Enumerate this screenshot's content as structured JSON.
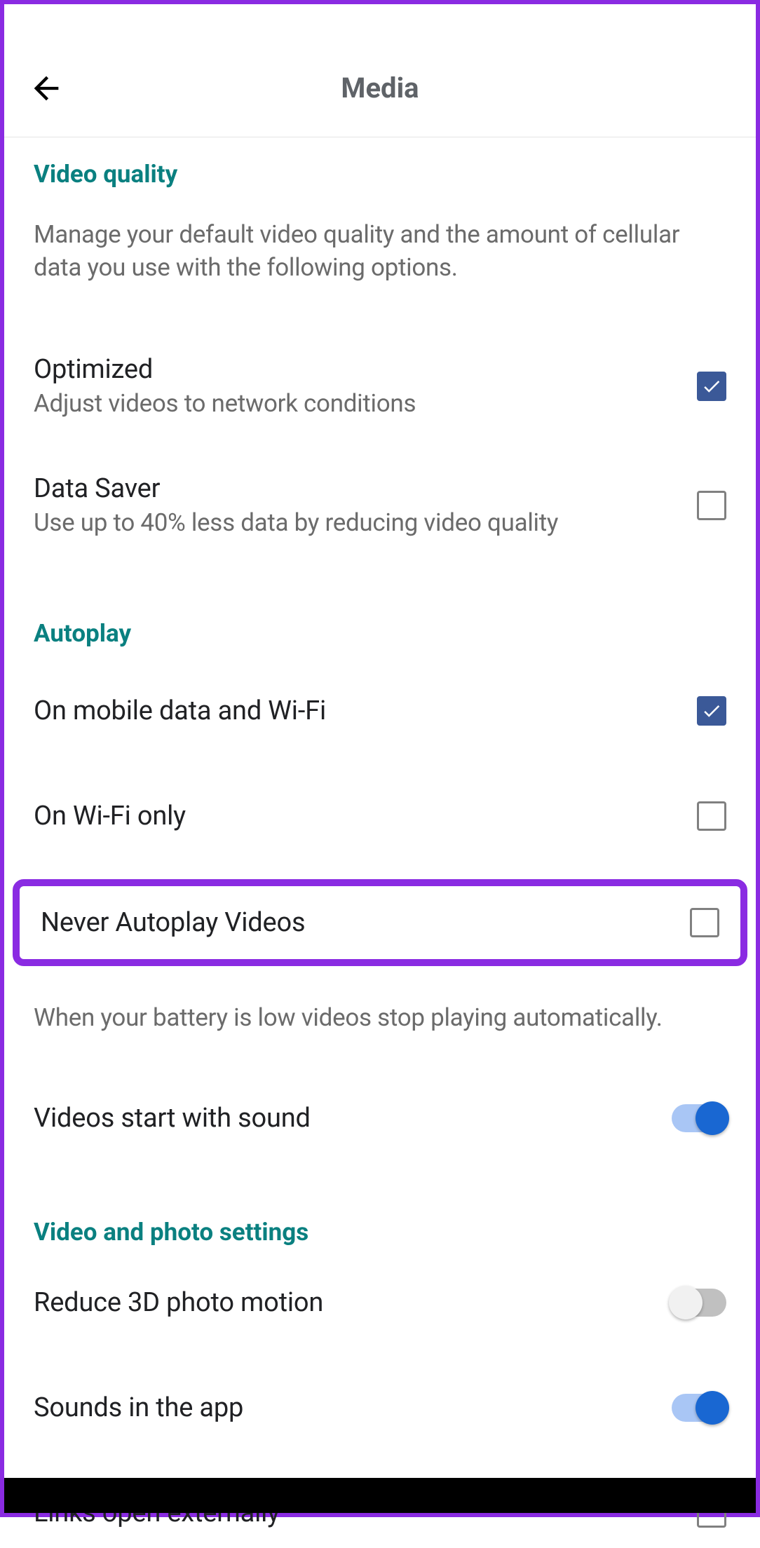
{
  "header": {
    "title": "Media"
  },
  "sections": {
    "video_quality": {
      "title": "Video quality",
      "desc": "Manage your default video quality and the amount of cellular data you use with the following options.",
      "optimized": {
        "label": "Optimized",
        "sub": "Adjust videos to network conditions"
      },
      "data_saver": {
        "label": "Data Saver",
        "sub": "Use up to 40% less data by reducing video quality"
      }
    },
    "autoplay": {
      "title": "Autoplay",
      "mobile_wifi": "On mobile data and Wi-Fi",
      "wifi_only": "On Wi-Fi only",
      "never": "Never Autoplay Videos",
      "footnote": "When your battery is low videos stop playing automatically.",
      "sound": "Videos start with sound"
    },
    "video_photo": {
      "title": "Video and photo settings",
      "reduce_3d": "Reduce 3D photo motion",
      "sounds_app": "Sounds in the app",
      "links_external": "Links open externally"
    }
  }
}
